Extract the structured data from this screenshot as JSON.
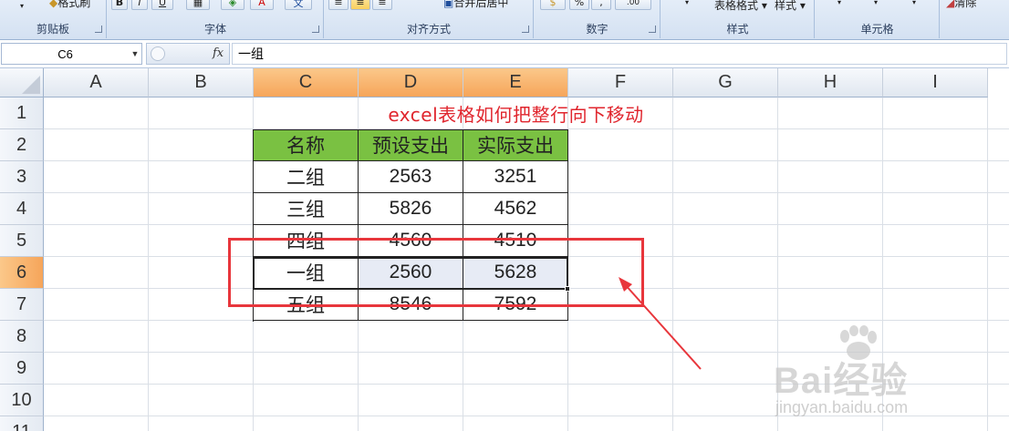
{
  "ribbon": {
    "groups": [
      {
        "label": "剪贴板"
      },
      {
        "label": "字体"
      },
      {
        "label": "对齐方式"
      },
      {
        "label": "数字"
      },
      {
        "label": "样式"
      },
      {
        "label": "单元格"
      }
    ],
    "format_painter_label": "格式刷",
    "bold": "B",
    "italic": "I",
    "underline": "U",
    "font_color_glyph": "A",
    "phonetic_glyph": "文",
    "merge_label": "合并后居中",
    "percent_glyph": "%",
    "comma_glyph": ",",
    "decimal_glyph": ".00",
    "table_format_label": "表格格式 ▾",
    "cell_style_label": "样式 ▾",
    "clear_label": "清除"
  },
  "formula_bar": {
    "name_box": "C6",
    "fx_label": "fx",
    "content": "一组"
  },
  "columns": [
    "A",
    "B",
    "C",
    "D",
    "E",
    "F",
    "G",
    "H",
    "I"
  ],
  "rows": [
    "1",
    "2",
    "3",
    "4",
    "5",
    "6",
    "7",
    "8",
    "9",
    "10",
    "11"
  ],
  "selected_columns": [
    "C",
    "D",
    "E"
  ],
  "selected_row": "6",
  "sheet": {
    "title": "excel表格如何把整行向下移动",
    "table": {
      "headers": [
        "名称",
        "预设支出",
        "实际支出"
      ],
      "rows": [
        [
          "二组",
          "2563",
          "3251"
        ],
        [
          "三组",
          "5826",
          "4562"
        ],
        [
          "四组",
          "4560",
          "4510"
        ],
        [
          "一组",
          "2560",
          "5628"
        ],
        [
          "五组",
          "8546",
          "7592"
        ]
      ]
    }
  },
  "colors": {
    "header_fill": "#7ac142",
    "title_text": "#e0252d",
    "annotation_red": "#e8363c",
    "selected_header": "#f6a55a",
    "highlight_fill": "#e7ebf5"
  },
  "watermark": {
    "brand": "Bai经验",
    "url": "jingyan.baidu.com"
  }
}
